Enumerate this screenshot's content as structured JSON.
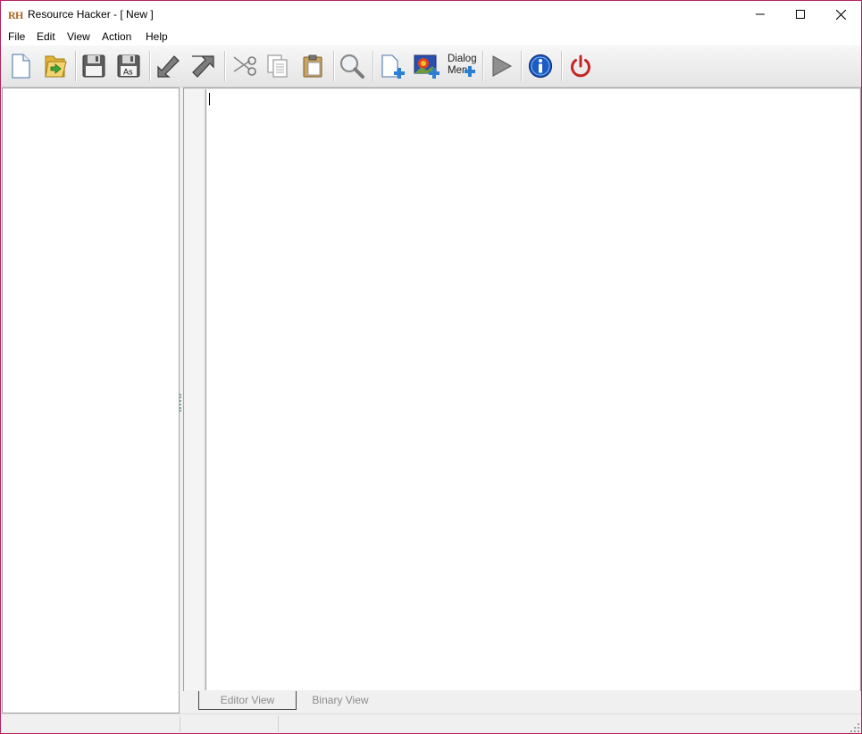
{
  "window": {
    "title": "Resource Hacker - [ New ]",
    "border_color": "#b2245f"
  },
  "caption_buttons": [
    "minimize-icon",
    "maximize-icon",
    "close-icon"
  ],
  "menu": {
    "file": "File",
    "edit": "Edit",
    "view": "View",
    "action": "Action",
    "help": "Help"
  },
  "toolbar": {
    "buttons": [
      {
        "name": "new-file",
        "icon": "new-document-icon"
      },
      {
        "name": "open-file",
        "icon": "open-folder-icon"
      },
      {
        "name": "save",
        "icon": "floppy-disk-icon"
      },
      {
        "name": "save-as",
        "icon": "floppy-disk-as-icon"
      },
      {
        "name": "back",
        "icon": "arrow-back-icon"
      },
      {
        "name": "forward",
        "icon": "arrow-forward-icon"
      },
      {
        "name": "cut",
        "icon": "scissors-icon"
      },
      {
        "name": "copy",
        "icon": "copy-icon"
      },
      {
        "name": "paste",
        "icon": "paste-icon"
      },
      {
        "name": "find",
        "icon": "magnifier-icon"
      },
      {
        "name": "add-resource",
        "icon": "add-blank-resource-icon"
      },
      {
        "name": "add-image-resource",
        "icon": "add-image-icon"
      },
      {
        "name": "dialog-menu",
        "icon": "dialog-merge-icon"
      },
      {
        "name": "compile",
        "icon": "play-icon"
      },
      {
        "name": "about",
        "icon": "info-icon"
      },
      {
        "name": "exit",
        "icon": "power-icon"
      }
    ],
    "dialog_label_line1": "Dialog",
    "dialog_label_line2": "Men"
  },
  "tabs": {
    "editor_view": "Editor View",
    "binary_view": "Binary View"
  },
  "colors": {
    "accent": "#b2245f",
    "info_blue": "#1a5bc4",
    "power_red": "#c42525",
    "plus_blue": "#2a7fd4"
  }
}
